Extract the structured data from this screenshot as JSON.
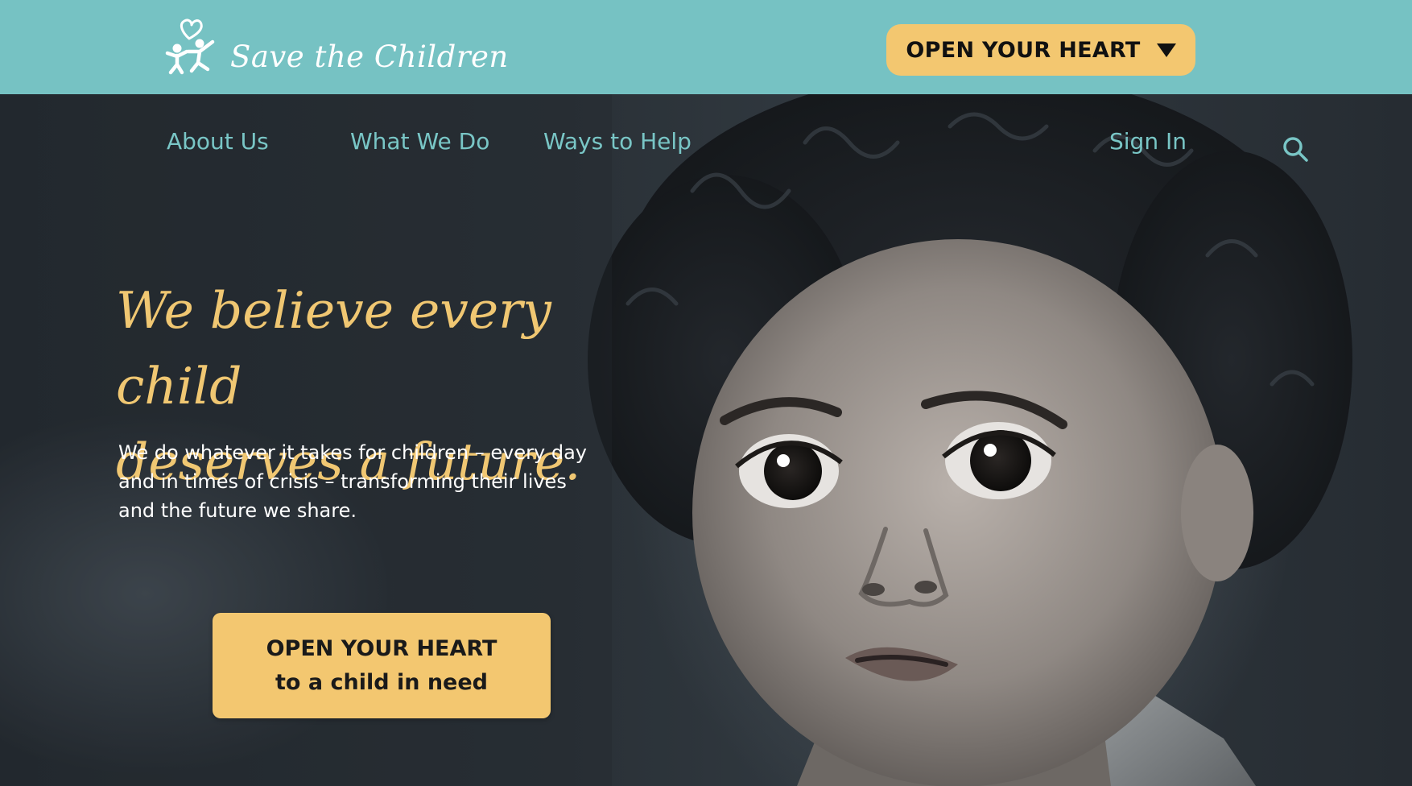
{
  "brand": {
    "name": "Save the Children",
    "topbar_color": "#76c2c3",
    "accent_color": "#f3c770",
    "headline_color": "#f0c772",
    "nav_color": "#79c6c6"
  },
  "header": {
    "logo_icon": "children-heart-icon",
    "cta_label": "OPEN YOUR HEART",
    "cta_icon": "caret-down-icon"
  },
  "nav": {
    "items": [
      {
        "label": "About Us"
      },
      {
        "label": "What We Do"
      },
      {
        "label": "Ways to Help"
      }
    ],
    "sign_in": "Sign In",
    "search_icon": "search-icon"
  },
  "hero": {
    "headline_line1": "We believe every child",
    "headline_line2": "deserves a future.",
    "body": "We do whatever it takes for children – every day and in times of crisis – transforming their lives and the future we share.",
    "cta_line1": "OPEN YOUR HEART",
    "cta_line2": "to a child in need"
  }
}
